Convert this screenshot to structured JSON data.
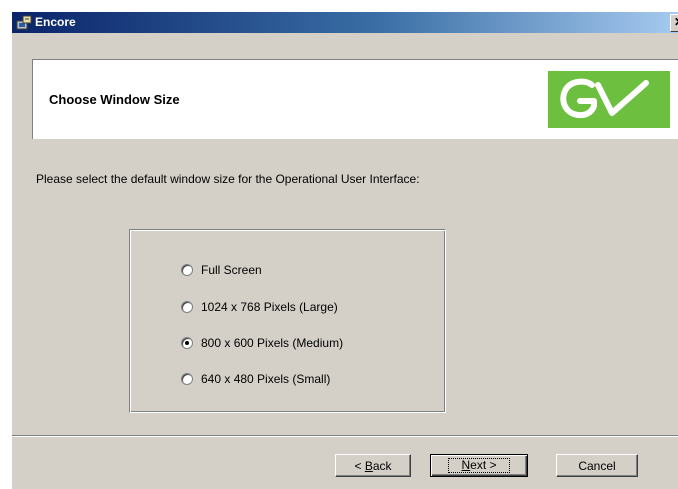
{
  "window": {
    "title": "Encore",
    "close_glyph": "✕",
    "icon": "installer-icon"
  },
  "header": {
    "title": "Choose Window Size",
    "logo": "grass-valley-gv-logo",
    "logo_text": "GV",
    "logo_color": "#6cbf3f"
  },
  "instruction": "Please select the default window size for the Operational User Interface:",
  "window_size_options": [
    {
      "label": "Full Screen",
      "selected": false
    },
    {
      "label": "1024 x 768 Pixels (Large)",
      "selected": false
    },
    {
      "label": "800 x 600 Pixels (Medium)",
      "selected": true
    },
    {
      "label": "640 x 480 Pixels (Small)",
      "selected": false
    }
  ],
  "buttons": {
    "back": {
      "prefix": "< ",
      "mnemonic": "B",
      "rest": "ack"
    },
    "next": {
      "mnemonic": "N",
      "rest": "ext >"
    },
    "cancel": "Cancel"
  },
  "colors": {
    "titlebar_start": "#0a246a",
    "titlebar_end": "#a6caf0",
    "dialog_face": "#d4d0c8"
  }
}
